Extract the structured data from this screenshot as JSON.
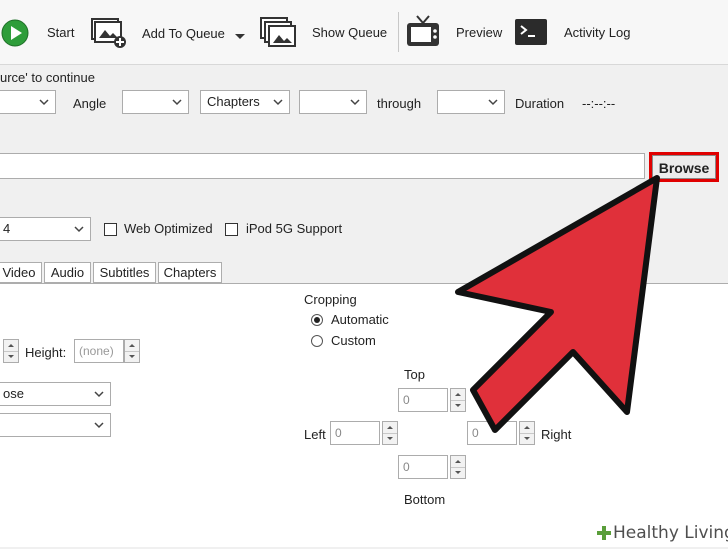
{
  "toolbar": {
    "start": "Start",
    "add_to_queue": "Add To Queue",
    "show_queue": "Show Queue",
    "preview": "Preview",
    "activity_log": "Activity Log"
  },
  "source": {
    "hint": "urce' to continue",
    "angle_label": "Angle",
    "chapters_mode": "Chapters",
    "through_label": "through",
    "duration_label": "Duration",
    "duration_value": "--:--:--"
  },
  "destination": {
    "browse_label": "Browse"
  },
  "output": {
    "container_fragment": "4",
    "web_optimized_label": "Web Optimized",
    "web_optimized_checked": false,
    "ipod_label": "iPod 5G Support",
    "ipod_checked": false
  },
  "tabs": [
    "Video",
    "Audio",
    "Subtitles",
    "Chapters"
  ],
  "picture": {
    "height_label": "Height:",
    "height_placeholder": "(none)",
    "anamorphic_fragment": "ose",
    "cropping_title": "Cropping",
    "automatic_label": "Automatic",
    "custom_label": "Custom",
    "cropping_mode": "Automatic",
    "top_label": "Top",
    "bottom_label": "Bottom",
    "left_label": "Left",
    "right_label": "Right",
    "top_value": "0",
    "bottom_value": "0",
    "left_value": "0",
    "right_value": "0"
  },
  "watermark": {
    "text": "Healthy Living"
  },
  "colors": {
    "highlight_red": "#e00000",
    "arrow_red": "#e0303a",
    "watermark_green": "#5a9e3a"
  }
}
